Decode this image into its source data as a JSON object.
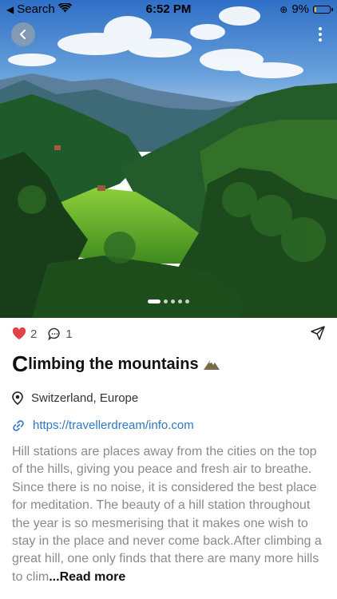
{
  "status": {
    "back_app": "Search",
    "time": "6:52 PM",
    "battery_pct": "9%",
    "battery_level": 0.09
  },
  "hero": {
    "image": "mountain-valley-photo",
    "slide_count": 5,
    "active_slide": 1
  },
  "post": {
    "likes": "2",
    "comments": "1",
    "title_cap": "C",
    "title_rest": "limbing the mountains",
    "location": "Switzerland, Europe",
    "link": "https://travellerdream/info.com",
    "description": "Hill stations are places away from the cities on the top of the hills, giving you peace and fresh air to breathe. Since there is no noise, it is considered the best place for meditation. The beauty of a hill station throughout the year is so mesmerising that it makes one wish to stay in the place and never come back.After climbing a great hill, one only finds that there are many more hills to clim",
    "read_more": "...Read more"
  },
  "colors": {
    "like": "#e0424a",
    "link": "#2f78c4",
    "text_muted": "#8a8a8a"
  },
  "icons": [
    "wifi-icon",
    "lock-rotation-icon",
    "back-icon",
    "more-icon",
    "heart-icon",
    "comment-icon",
    "share-icon",
    "location-pin-icon",
    "link-icon",
    "mountain-emoji-icon"
  ]
}
